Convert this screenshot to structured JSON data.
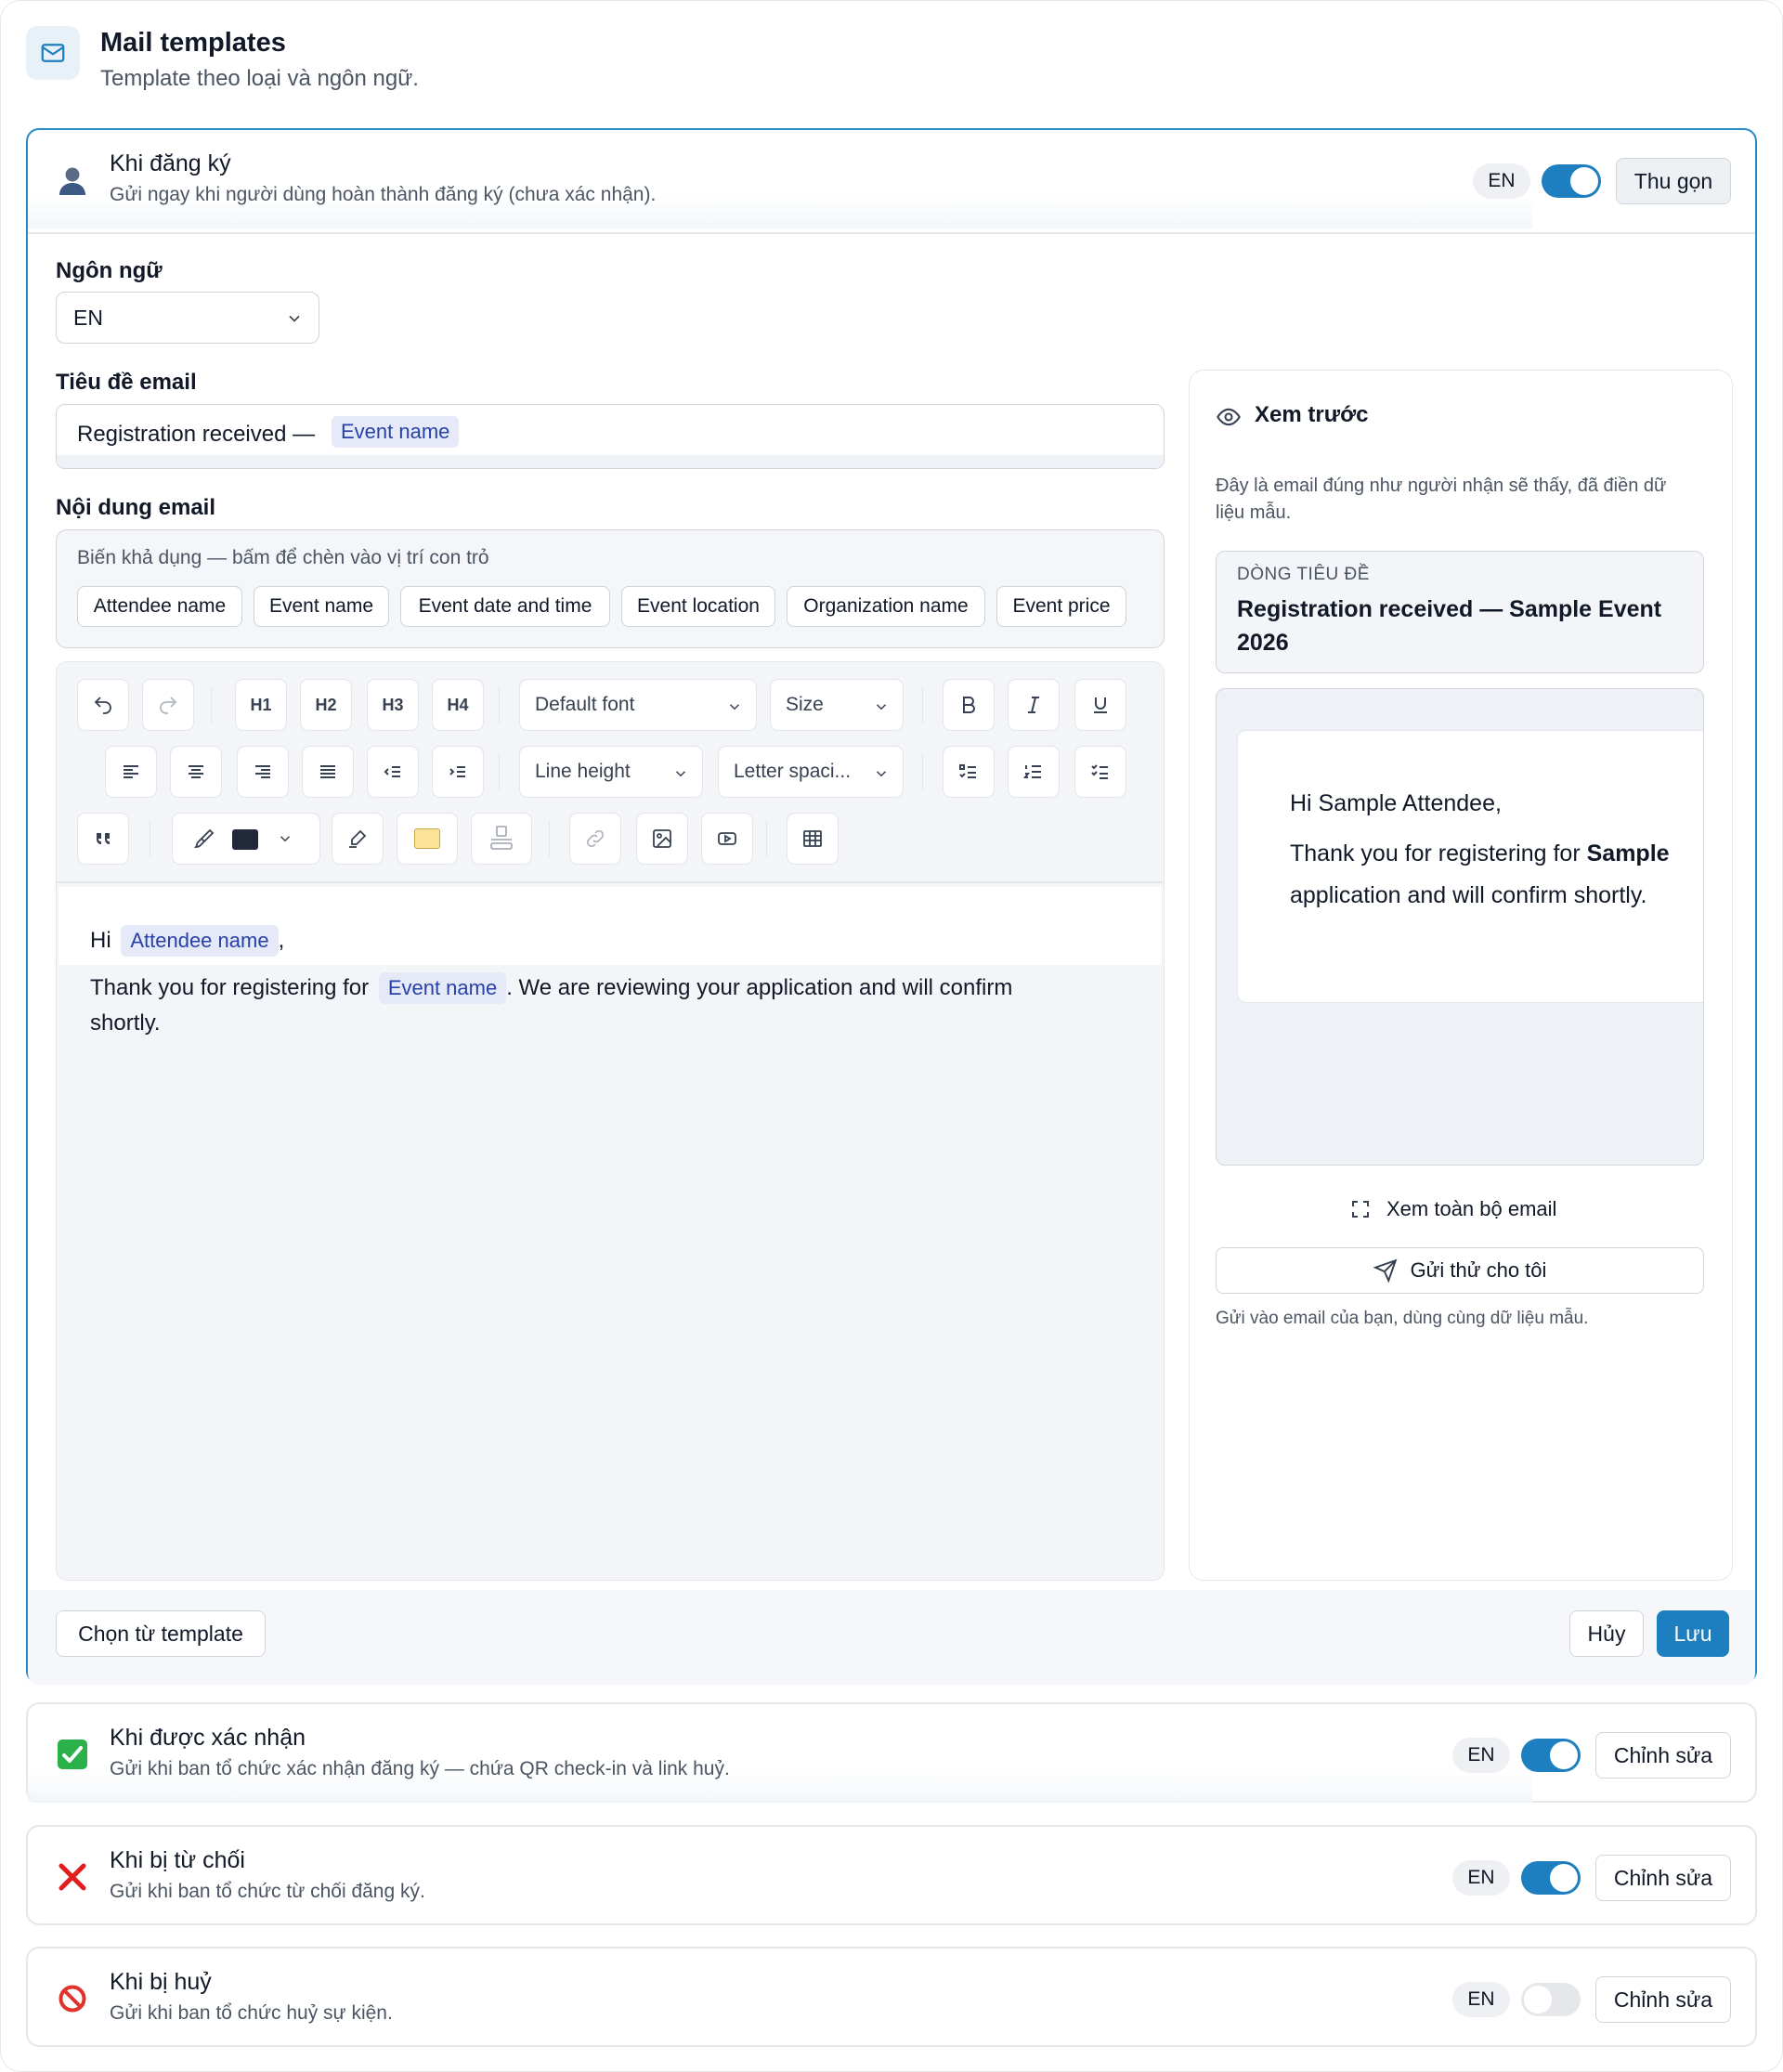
{
  "header": {
    "title": "Mail templates",
    "subtitle": "Template theo loại và ngôn ngữ."
  },
  "open_card": {
    "title": "Khi đăng ký",
    "desc": "Gửi ngay khi người dùng hoàn thành đăng ký (chưa xác nhận).",
    "lang": "EN",
    "enabled": true,
    "collapse_label": "Thu gọn",
    "language_label": "Ngôn ngữ",
    "language_value": "EN",
    "subject_label": "Tiêu đề email",
    "subject_prefix": "Registration received —",
    "subject_var": "Event name",
    "body_label": "Nội dung email",
    "vars_hint": "Biến khả dụng — bấm để chèn vào vị trí con trỏ",
    "variables": [
      "Attendee name",
      "Event name",
      "Event date and time",
      "Event location",
      "Organization name",
      "Event price"
    ],
    "toolbar": {
      "headings": [
        "H1",
        "H2",
        "H3",
        "H4"
      ],
      "font": "Default font",
      "size": "Size",
      "line_height": "Line height",
      "letter_spacing": "Letter spaci...",
      "text_color": "#1f2937",
      "highlight_color": "#fbe49a"
    },
    "body": {
      "greeting": "Hi",
      "greeting_var": "Attendee name",
      "greeting_end": ",",
      "line1_prefix": "Thank you for registering for",
      "line1_var": "Event name",
      "line1_suffix": ". We are reviewing your application and will confirm",
      "line2": "shortly."
    },
    "preview": {
      "title": "Xem trước",
      "note_1": "Đây là email đúng như người nhận sẽ thấy, đã điền dữ",
      "note_2": "liệu mẫu.",
      "subject_caption": "DÒNG TIÊU ĐỀ",
      "subject": "Registration received — Sample Event 2026",
      "mail_greeting": "Hi Sample Attendee,",
      "mail_line1_prefix": "Thank you for registering for",
      "mail_line1_bold": "Sample",
      "mail_line2": "application and will confirm shortly.",
      "full_view": "Xem toàn bộ email",
      "send_test": "Gửi thử cho tôi",
      "send_note": "Gửi vào email của bạn, dùng cùng dữ liệu mẫu."
    },
    "choose_template": "Chọn từ template",
    "cancel": "Hủy",
    "save": "Lưu"
  },
  "cards": [
    {
      "title": "Khi được xác nhận",
      "desc": "Gửi khi ban tổ chức xác nhận đăng ký — chứa QR check-in và link huỷ.",
      "lang": "EN",
      "enabled": true,
      "edit": "Chỉnh sửa",
      "icon": "check-mark-icon"
    },
    {
      "title": "Khi bị từ chối",
      "desc": "Gửi khi ban tổ chức từ chối đăng ký.",
      "lang": "EN",
      "enabled": true,
      "edit": "Chỉnh sửa",
      "icon": "cross-mark-icon"
    },
    {
      "title": "Khi bị huỷ",
      "desc": "Gửi khi ban tổ chức huỷ sự kiện.",
      "lang": "EN",
      "enabled": false,
      "edit": "Chỉnh sửa",
      "icon": "prohibited-icon"
    }
  ],
  "colors": {
    "accent": "#1d7fc0",
    "variable_chip_bg": "#e6eaf8",
    "variable_chip_text": "#2741a8"
  }
}
